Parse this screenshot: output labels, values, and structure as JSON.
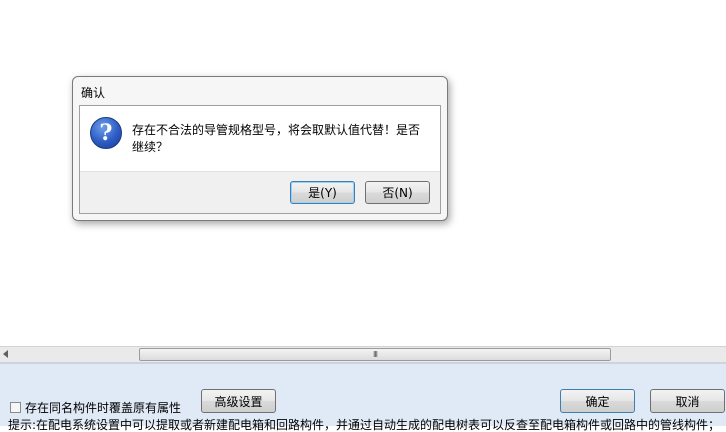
{
  "dialog": {
    "title": "确认",
    "icon": "question-icon",
    "message": "存在不合法的导管规格型号，将会取默认值代替！是否继续？",
    "yes_label": "是(Y)",
    "no_label": "否(N)"
  },
  "bottom_panel": {
    "overwrite_checkbox_label": "存在同名构件时覆盖原有属性",
    "overwrite_checked": false,
    "advanced_label": "高级设置",
    "ok_label": "确定",
    "cancel_label": "取消",
    "hint_text": "提示:在配电系统设置中可以提取或者新建配电箱和回路构件，并通过自动生成的配电树表可以反查至配电箱构件或回路中的管线构件；"
  },
  "scrollbar": {
    "grip": "III"
  }
}
